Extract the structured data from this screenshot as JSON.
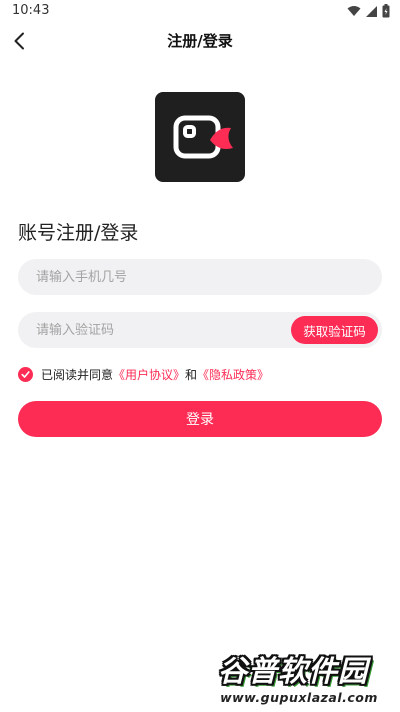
{
  "status_bar": {
    "time": "10:43"
  },
  "nav": {
    "title": "注册/登录"
  },
  "section": {
    "title": "账号注册/登录"
  },
  "phone": {
    "placeholder": "请输入手机几号",
    "value": ""
  },
  "code": {
    "placeholder": "请输入验证码",
    "value": "",
    "button_label": "获取验证码"
  },
  "agreement": {
    "checked": true,
    "prefix": "已阅读并同意",
    "user_agreement": "《用户协议》",
    "conjunction": "和",
    "privacy_policy": "《隐私政策》"
  },
  "login": {
    "label": "登录"
  },
  "watermark": {
    "main": "谷普软件园",
    "url": "www.gupuxlazal.com"
  },
  "colors": {
    "accent": "#fd2c55",
    "logo_bg": "#1f1f1f",
    "field_bg": "#f1f1f3",
    "watermark_green": "#3b9c3a"
  },
  "icons": [
    "wifi-icon",
    "signal-icon",
    "battery-icon",
    "back-arrow-icon",
    "app-logo-icon",
    "check-icon"
  ]
}
